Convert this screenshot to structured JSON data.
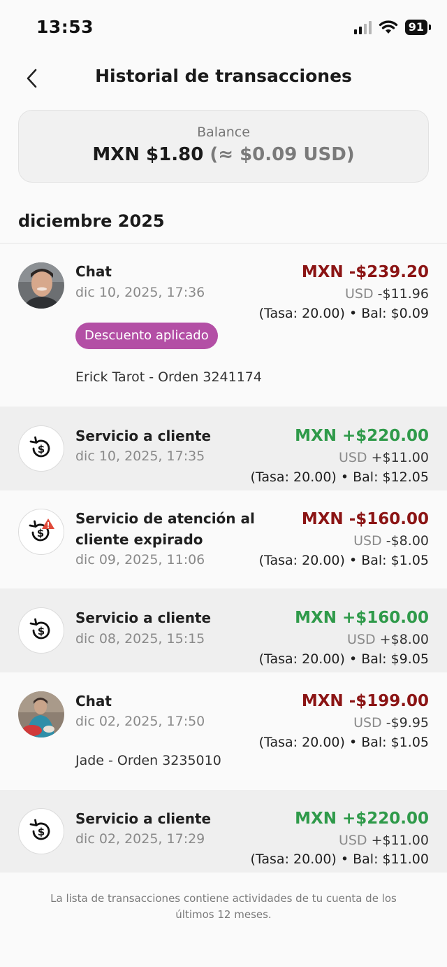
{
  "status_bar": {
    "time": "13:53",
    "battery": "91"
  },
  "header": {
    "title": "Historial de transacciones"
  },
  "balance": {
    "label": "Balance",
    "amount": "MXN $1.80",
    "usd_equiv": "(≈ $0.09 USD)"
  },
  "month": "diciembre 2025",
  "transactions": [
    {
      "title": "Chat",
      "date": "dic 10, 2025, 17:36",
      "amount": "MXN -$239.20",
      "usd_currency": "USD",
      "usd_value": " -$11.96",
      "rate": "(Tasa: 20.00) • Bal: $0.09",
      "badge": "Descuento aplicado",
      "note": "Erick Tarot - Orden 3241174"
    },
    {
      "title": "Servicio a cliente",
      "date": "dic 10, 2025, 17:35",
      "amount": "MXN +$220.00",
      "usd_currency": "USD",
      "usd_value": " +$11.00",
      "rate": "(Tasa: 20.00) • Bal: $12.05"
    },
    {
      "title_line1": "Servicio de atención al",
      "title_line2": "cliente expirado",
      "date": "dic 09, 2025, 11:06",
      "amount": "MXN -$160.00",
      "usd_currency": "USD",
      "usd_value": " -$8.00",
      "rate": "(Tasa: 20.00) • Bal: $1.05"
    },
    {
      "title": "Servicio a cliente",
      "date": "dic 08, 2025, 15:15",
      "amount": "MXN +$160.00",
      "usd_currency": "USD",
      "usd_value": " +$8.00",
      "rate": "(Tasa: 20.00) • Bal: $9.05"
    },
    {
      "title": "Chat",
      "date": "dic 02, 2025, 17:50",
      "amount": "MXN -$199.00",
      "usd_currency": "USD",
      "usd_value": " -$9.95",
      "rate": "(Tasa: 20.00) • Bal: $1.05",
      "note": "Jade - Orden 3235010"
    },
    {
      "title": "Servicio a cliente",
      "date": "dic 02, 2025, 17:29",
      "amount": "MXN +$220.00",
      "usd_currency": "USD",
      "usd_value": " +$11.00",
      "rate": "(Tasa: 20.00) • Bal: $11.00"
    }
  ],
  "footer": "La lista de transacciones contiene actividades de tu cuenta de los últimos 12 meses.",
  "icons": {
    "back": "chevron-left-icon",
    "service": "refund-dollar-icon",
    "service_expired": "refund-dollar-alert-icon",
    "wifi": "wifi-icon",
    "signal": "cellular-signal-icon",
    "battery": "battery-icon"
  },
  "colors": {
    "negative": "#8b1414",
    "positive": "#2f9a4a",
    "badge": "#b34fa5",
    "alert": "#e04a3a"
  }
}
